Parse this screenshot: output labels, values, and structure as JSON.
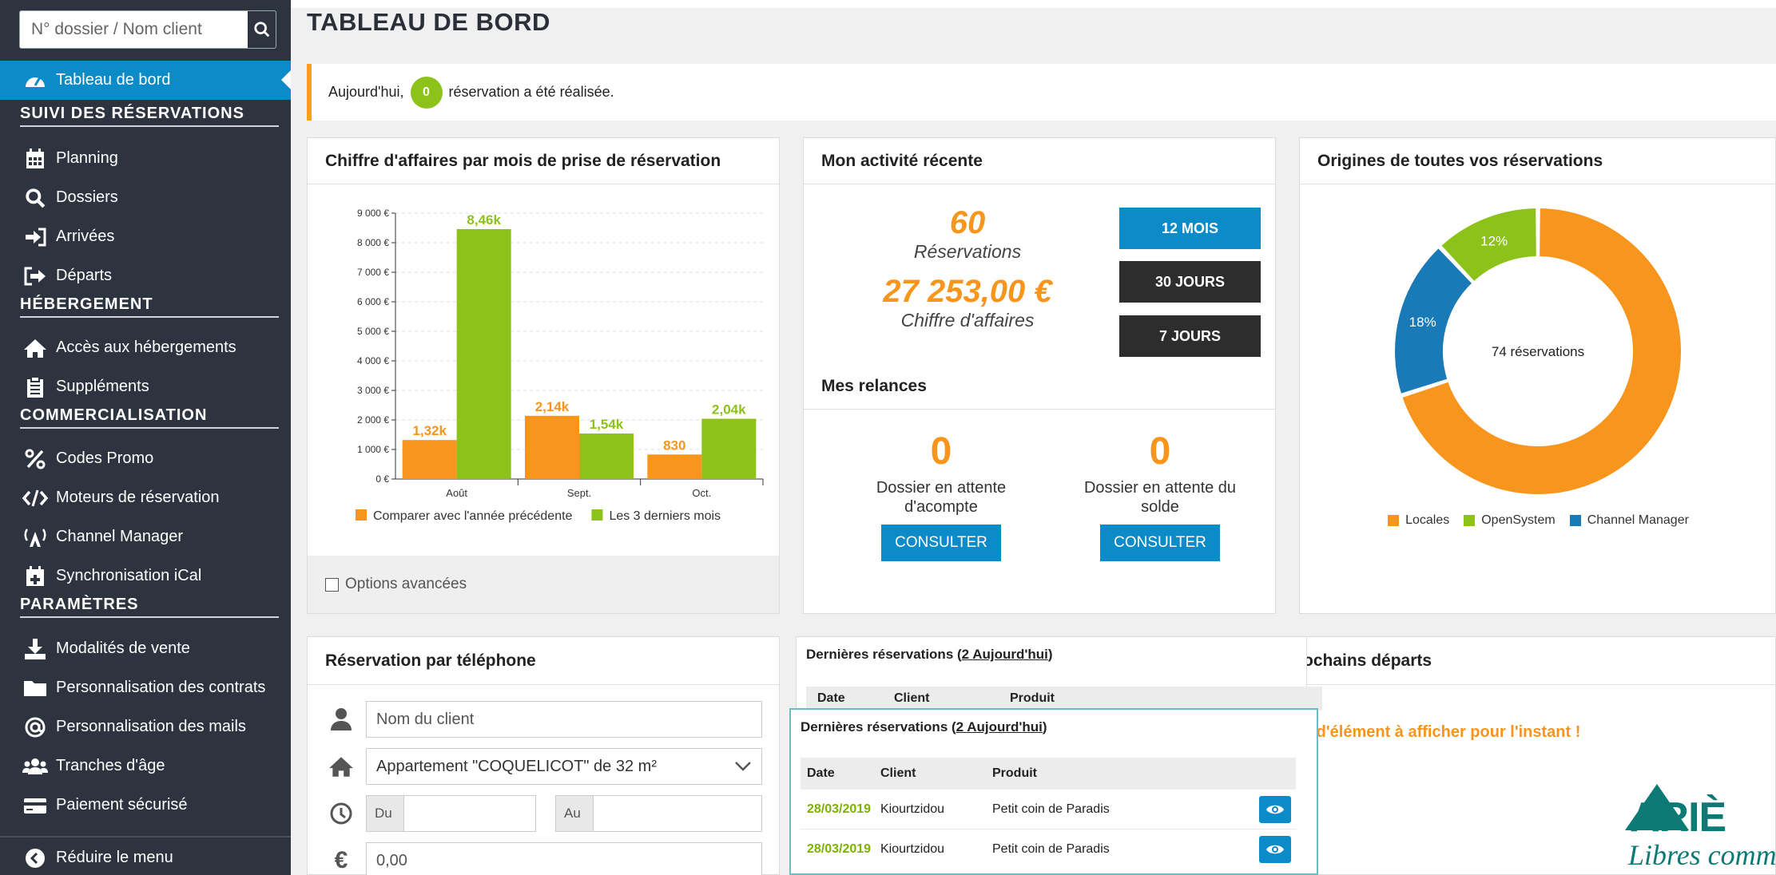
{
  "search": {
    "placeholder": "N° dossier / Nom client"
  },
  "sidebar": {
    "items": [
      {
        "label": "Tableau de bord",
        "icon": "dashboard-icon"
      },
      {
        "label": "Planning",
        "icon": "calendar-icon"
      },
      {
        "label": "Dossiers",
        "icon": "search-icon"
      },
      {
        "label": "Arrivées",
        "icon": "sign-in-icon"
      },
      {
        "label": "Départs",
        "icon": "sign-out-icon"
      },
      {
        "label": "Accès aux hébergements",
        "icon": "home-icon"
      },
      {
        "label": "Suppléments",
        "icon": "clipboard-icon"
      },
      {
        "label": "Codes Promo",
        "icon": "percent-icon"
      },
      {
        "label": "Moteurs de réservation",
        "icon": "code-icon"
      },
      {
        "label": "Channel Manager",
        "icon": "broadcast-icon"
      },
      {
        "label": "Synchronisation iCal",
        "icon": "calendar-plus-icon"
      },
      {
        "label": "Modalités de vente",
        "icon": "download-icon"
      },
      {
        "label": "Personnalisation des contrats",
        "icon": "folder-icon"
      },
      {
        "label": "Personnalisation des mails",
        "icon": "at-icon"
      },
      {
        "label": "Tranches d'âge",
        "icon": "users-icon"
      },
      {
        "label": "Paiement sécurisé",
        "icon": "credit-card-icon"
      },
      {
        "label": "Réduire le menu",
        "icon": "chevron-left-icon"
      }
    ],
    "sections": [
      "SUIVI DES RÉSERVATIONS",
      "HÉBERGEMENT",
      "COMMERCIALISATION",
      "PARAMÈTRES"
    ]
  },
  "page": {
    "title": "TABLEAU DE BORD"
  },
  "alert": {
    "prefix": "Aujourd'hui,",
    "count": "0",
    "suffix": "réservation a été réalisée."
  },
  "revenue_card": {
    "title": "Chiffre d'affaires par mois de prise de réservation",
    "options": "Options avancées"
  },
  "chart_data": {
    "type": "bar",
    "categories": [
      "Août",
      "Sept.",
      "Oct."
    ],
    "series": [
      {
        "name": "Comparer avec l'année précédente",
        "values": [
          1320,
          2140,
          830
        ],
        "labels": [
          "1,32k",
          "2,14k",
          "830"
        ],
        "color": "#f7951d"
      },
      {
        "name": "Les 3 derniers mois",
        "values": [
          8460,
          1540,
          2040
        ],
        "labels": [
          "8,46k",
          "1,54k",
          "2,04k"
        ],
        "color": "#8cc21a"
      }
    ],
    "yticks": [
      "9 000 €",
      "8 000 €",
      "7 000 €",
      "6 000 €",
      "5 000 €",
      "4 000 €",
      "3 000 €",
      "2 000 €",
      "1 000 €",
      "0 €"
    ],
    "ylim": [
      0,
      9000
    ]
  },
  "activity": {
    "title": "Mon activité récente",
    "reservations": "60",
    "reservations_label": "Réservations",
    "revenue": "27 253,00 €",
    "revenue_label": "Chiffre d'affaires",
    "periods": [
      "12 MOIS",
      "30 JOURS",
      "7 JOURS"
    ],
    "relances_title": "Mes relances",
    "relances": [
      {
        "count": "0",
        "label": "Dossier en attente d'acompte",
        "button": "CONSULTER"
      },
      {
        "count": "0",
        "label": "Dossier en attente du solde",
        "button": "CONSULTER"
      }
    ]
  },
  "origins": {
    "title": "Origines de toutes vos réservations",
    "center": "74 réservations",
    "slices": [
      {
        "name": "Locales",
        "pct": 70,
        "label": "70%",
        "color": "#f7951d"
      },
      {
        "name": "OpenSystem",
        "pct": 12,
        "label": "12%",
        "color": "#8cc21a"
      },
      {
        "name": "Channel Manager",
        "pct": 18,
        "label": "18%",
        "color": "#1a7ab8"
      }
    ]
  },
  "phone": {
    "title": "Réservation par téléphone",
    "client_placeholder": "Nom du client",
    "lodging": "Appartement \"COQUELICOT\" de 32 m²",
    "from": "Du",
    "to": "Au",
    "amount": "0,00"
  },
  "latest": {
    "title": "Dernières réservations",
    "today": "2 Aujourd'hui",
    "headers": [
      "Date",
      "Client",
      "Produit"
    ],
    "rows": [
      {
        "date": "28/03/2019",
        "client": "Kiourtzidou",
        "product": "Petit coin de Paradis"
      },
      {
        "date": "28/03/2019",
        "client": "Kiourtzidou",
        "product": "Petit coin de Paradis"
      }
    ]
  },
  "departures": {
    "title": "ochains départs",
    "empty": "s d'élément à afficher pour l'instant !"
  },
  "brand": {
    "logo": "ARIÈ",
    "tagline": "Libres comme"
  }
}
